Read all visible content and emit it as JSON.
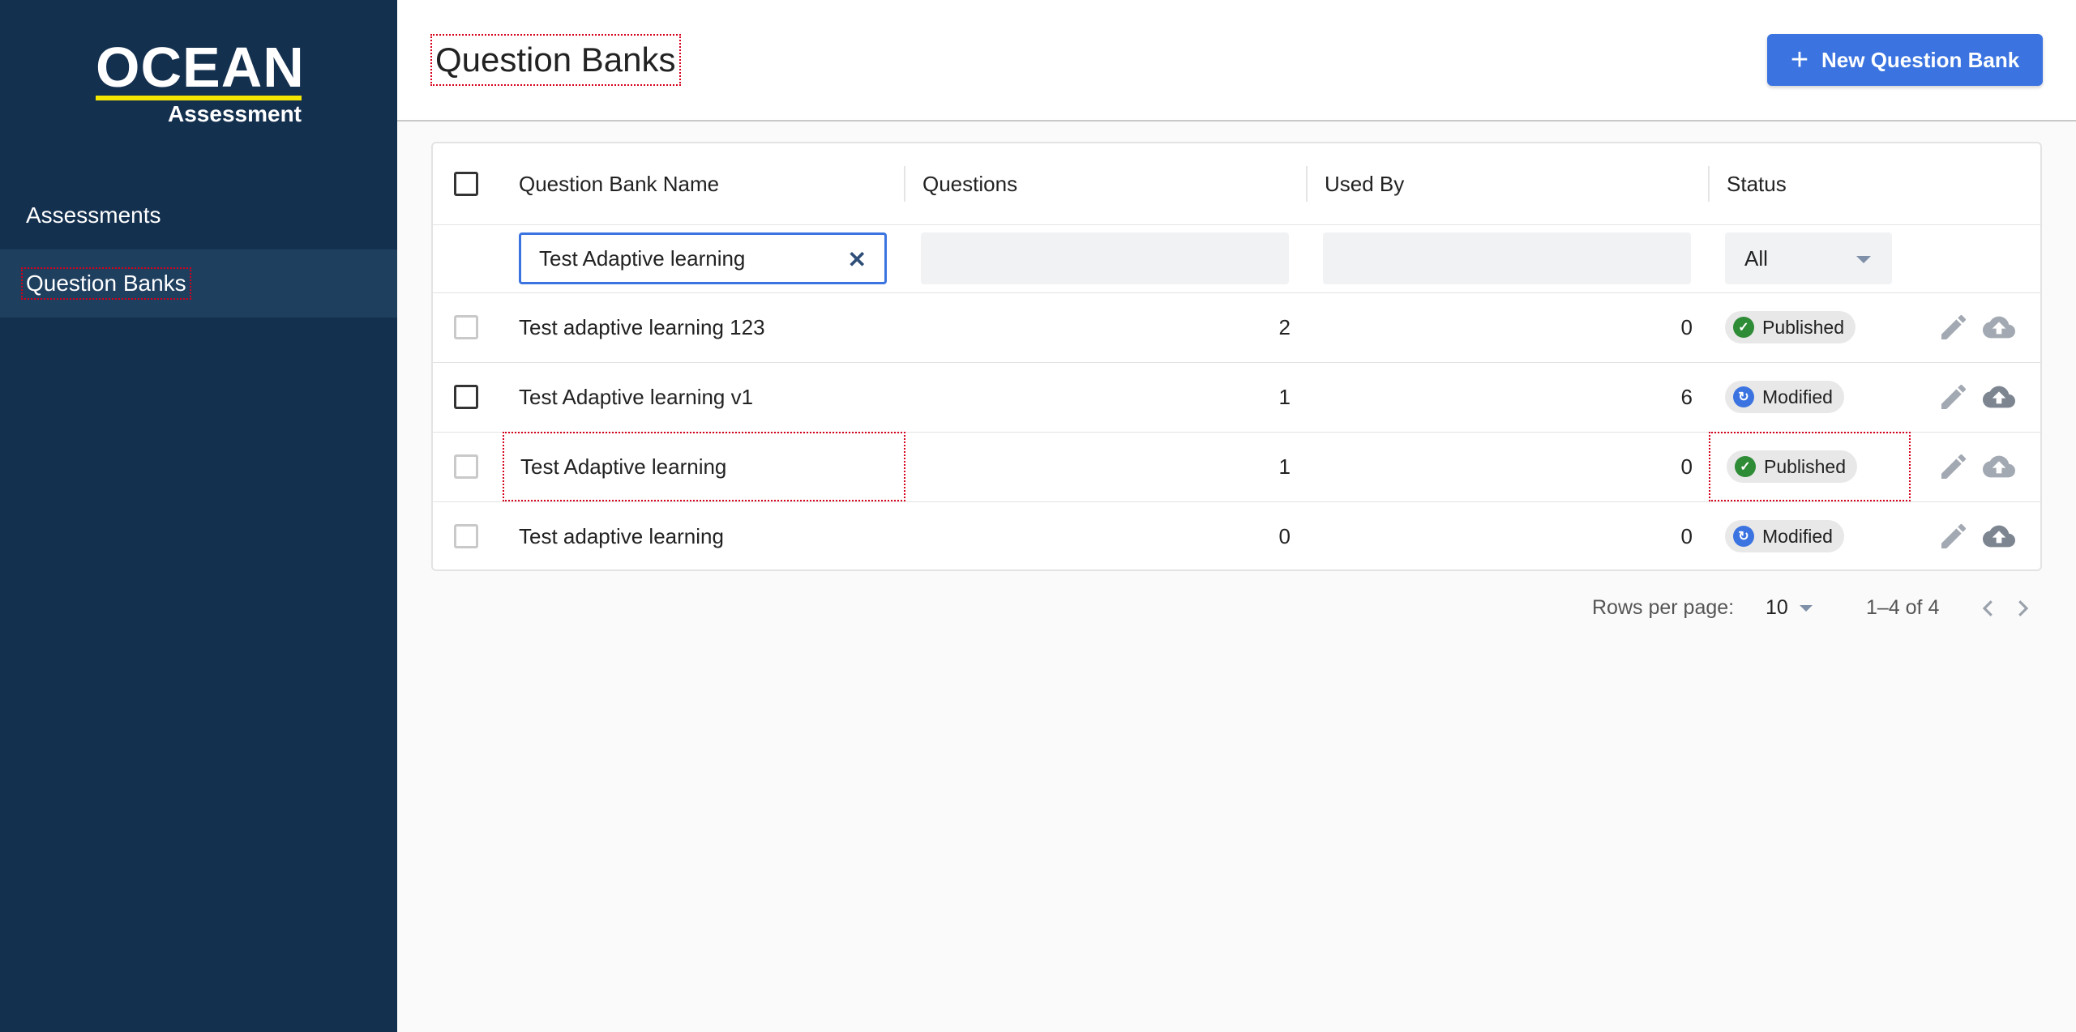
{
  "brand": {
    "name": "OCEAN",
    "sub": "Assessment"
  },
  "sidebar": {
    "items": [
      {
        "label": "Assessments"
      },
      {
        "label": "Question Banks"
      }
    ]
  },
  "header": {
    "title": "Question Banks",
    "new_button": "New Question Bank"
  },
  "table": {
    "columns": [
      "Question Bank Name",
      "Questions",
      "Used By",
      "Status"
    ],
    "filters": {
      "name_value": "Test Adaptive learning",
      "status_value": "All"
    },
    "rows": [
      {
        "name": "Test adaptive learning 123",
        "questions": "2",
        "used_by": "0",
        "status": "Published"
      },
      {
        "name": "Test Adaptive learning v1",
        "questions": "1",
        "used_by": "6",
        "status": "Modified"
      },
      {
        "name": "Test Adaptive learning",
        "questions": "1",
        "used_by": "0",
        "status": "Published"
      },
      {
        "name": "Test adaptive learning",
        "questions": "0",
        "used_by": "0",
        "status": "Modified"
      }
    ]
  },
  "pagination": {
    "rows_per_page_label": "Rows per page:",
    "rows_per_page": "10",
    "range": "1–4 of 4"
  },
  "colors": {
    "sidebar": "#14304f",
    "accent": "#3b74e0",
    "published": "#2e8b36",
    "modified": "#3b74e0",
    "logo_bar": "#f3e600"
  }
}
